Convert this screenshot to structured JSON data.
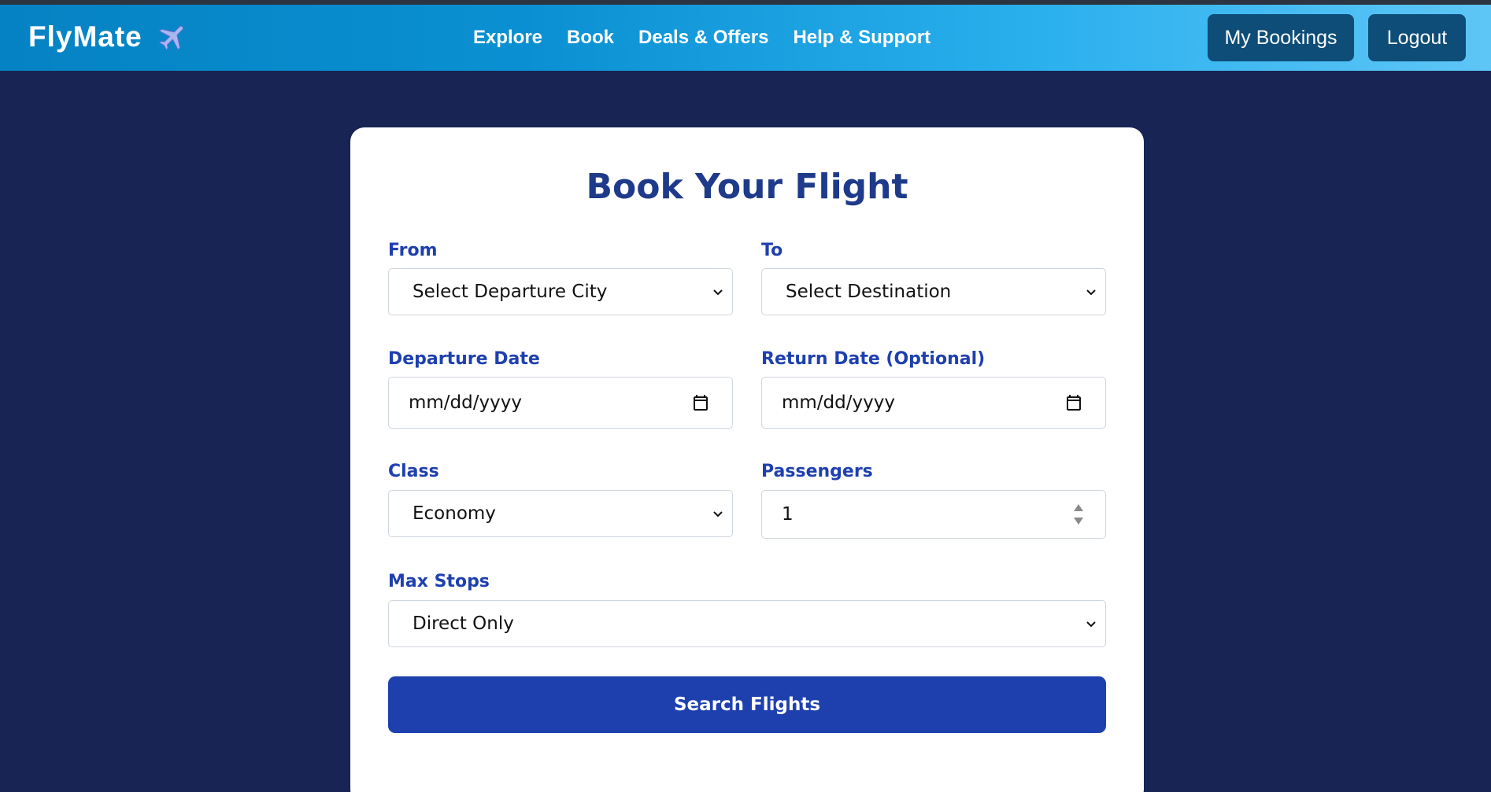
{
  "header": {
    "brand": "FlyMate",
    "brand_icon": "airplane-icon",
    "nav_links": [
      "Explore",
      "Book",
      "Deals & Offers",
      "Help & Support"
    ],
    "my_bookings_label": "My Bookings",
    "logout_label": "Logout"
  },
  "form": {
    "title": "Book Your Flight",
    "from": {
      "label": "From",
      "value": "Select Departure City"
    },
    "to": {
      "label": "To",
      "value": "Select Destination"
    },
    "departure_date": {
      "label": "Departure Date",
      "placeholder": "mm/dd/yyyy"
    },
    "return_date": {
      "label": "Return Date (Optional)",
      "placeholder": "mm/dd/yyyy"
    },
    "class": {
      "label": "Class",
      "value": "Economy"
    },
    "passengers": {
      "label": "Passengers",
      "value": "1"
    },
    "max_stops": {
      "label": "Max Stops",
      "value": "Direct Only"
    },
    "search_label": "Search Flights"
  },
  "colors": {
    "page_bg": "#182453",
    "header_gradient_start": "#0582c3",
    "header_gradient_end": "#5ec6f6",
    "header_button": "#0d4d78",
    "title_text": "#1e3a8a",
    "label_text": "#1e40af",
    "primary_button": "#1e40af"
  }
}
